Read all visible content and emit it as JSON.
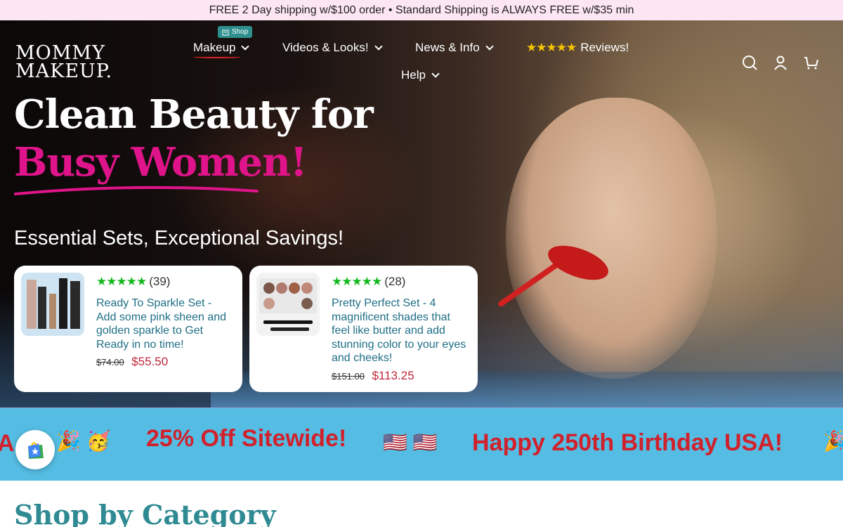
{
  "announcement": "FREE 2 Day shipping w/$100 order • Standard Shipping is ALWAYS FREE w/$35 min",
  "logo": {
    "line1": "MOMMY",
    "line2": "MAKEUP."
  },
  "nav": {
    "shop_badge": "Shop",
    "items": [
      {
        "label": "Makeup"
      },
      {
        "label": "Videos & Looks!"
      },
      {
        "label": "News & Info"
      },
      {
        "label": "Reviews!",
        "stars": "★★★★★"
      },
      {
        "label": "Help"
      }
    ]
  },
  "hero": {
    "line1": "Clean Beauty for",
    "line2": "Busy Women!",
    "subhead": "Essential Sets, Exceptional Savings!"
  },
  "products": [
    {
      "stars": "★★★★★",
      "count": "(39)",
      "title": "Ready To Sparkle Set - Add some pink sheen and golden sparkle to Get Ready in no time!",
      "old_price": "$74.00",
      "price": "$55.50"
    },
    {
      "stars": "★★★★★",
      "count": "(28)",
      "title": "Pretty Perfect Set - 4 magnificent shades that feel like butter and add stunning color to your eyes and cheeks!",
      "old_price": "$151.00",
      "price": "$113.25"
    }
  ],
  "promo": {
    "start": "A",
    "sale": "25% Off Sitewide!",
    "birthday": "Happy 250th Birthday USA!",
    "emoji_party": "🎉 🥳",
    "emoji_flags": "🇺🇸 🇺🇸",
    "emoji_end": "🎉"
  },
  "section_title": "Shop by Category",
  "colors": {
    "accent_pink": "#e0148a",
    "teal": "#2f8a93",
    "promo_bg": "#55bde3",
    "promo_text": "#d0212c"
  }
}
